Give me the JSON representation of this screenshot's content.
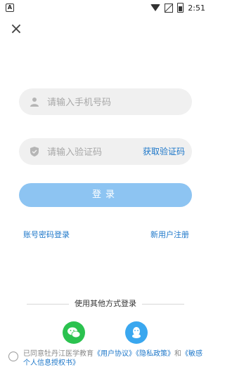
{
  "status_bar": {
    "time": "2:51",
    "left_icon": "A",
    "icons": [
      "wifi-icon",
      "no-sim-icon",
      "battery-icon"
    ]
  },
  "header": {
    "close_icon": "×"
  },
  "form": {
    "phone_placeholder": "请输入手机号码",
    "code_placeholder": "请输入验证码",
    "get_code_label": "获取验证码",
    "login_label": "登录",
    "password_login_label": "账号密码登录",
    "register_label": "新用户注册"
  },
  "other_login": {
    "title": "使用其他方式登录",
    "methods": [
      "wechat-icon",
      "qq-icon"
    ]
  },
  "agreement": {
    "prefix": "已同意牡丹江医学教育",
    "user_agreement": "《用户协议》",
    "privacy_policy": "《隐私政策》",
    "and": "和",
    "sensitive_info": "《敏感个人信息授权书》"
  },
  "colors": {
    "accent": "#1d77c9",
    "login_button": "#8dc4f2",
    "wechat": "#2bc24f",
    "qq": "#3aa7ef"
  }
}
